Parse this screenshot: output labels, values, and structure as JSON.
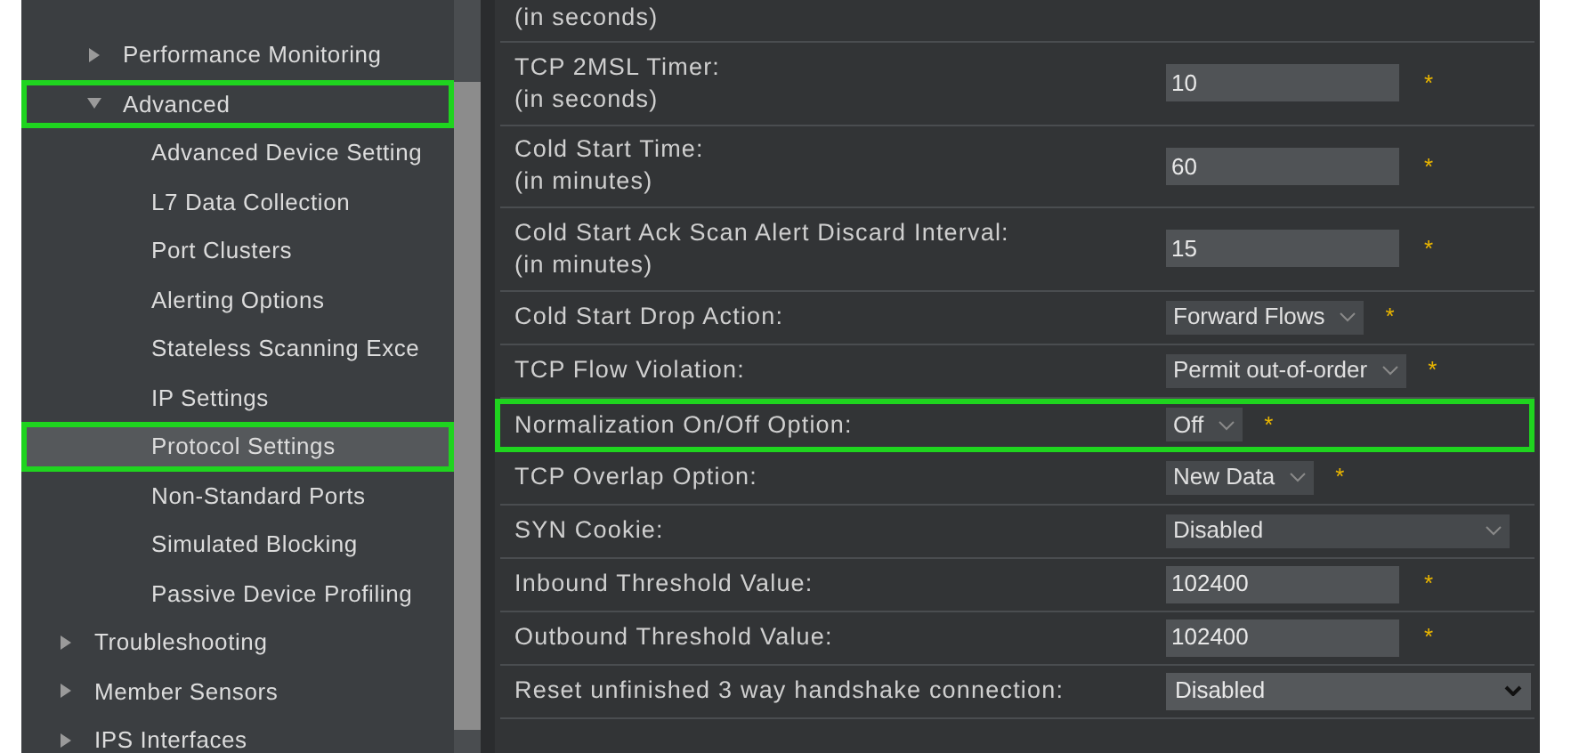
{
  "sidebar": {
    "group_items": [
      {
        "label": "Performance Monitoring",
        "expanded": false,
        "selected": false,
        "highlighted": false
      },
      {
        "label": "Advanced",
        "expanded": true,
        "selected": false,
        "highlighted": true,
        "children": [
          {
            "label": "Advanced Device Setting",
            "selected": false,
            "highlighted": false
          },
          {
            "label": "L7 Data Collection",
            "selected": false,
            "highlighted": false
          },
          {
            "label": "Port Clusters",
            "selected": false,
            "highlighted": false
          },
          {
            "label": "Alerting Options",
            "selected": false,
            "highlighted": false
          },
          {
            "label": "Stateless Scanning Exce",
            "selected": false,
            "highlighted": false
          },
          {
            "label": "IP Settings",
            "selected": false,
            "highlighted": false
          },
          {
            "label": "Protocol Settings",
            "selected": true,
            "highlighted": true
          },
          {
            "label": "Non-Standard Ports",
            "selected": false,
            "highlighted": false
          },
          {
            "label": "Simulated Blocking",
            "selected": false,
            "highlighted": false
          },
          {
            "label": "Passive Device Profiling",
            "selected": false,
            "highlighted": false
          }
        ]
      }
    ],
    "items": [
      {
        "label": "Troubleshooting",
        "expanded": false,
        "selected": false,
        "highlighted": false
      },
      {
        "label": "Member Sensors",
        "expanded": false,
        "selected": false,
        "highlighted": false
      },
      {
        "label": "IPS Interfaces",
        "expanded": false,
        "selected": false,
        "highlighted": false
      }
    ]
  },
  "settings": {
    "rows": [
      {
        "label": "(in seconds)",
        "kind": "partial",
        "highlighted": false
      },
      {
        "label": "TCP 2MSL Timer:",
        "sublabel": "(in seconds)",
        "kind": "input",
        "value": "10",
        "mark": "*",
        "highlighted": false
      },
      {
        "label": "Cold Start Time:",
        "sublabel": "(in minutes)",
        "kind": "input",
        "value": "60",
        "mark": "*",
        "highlighted": false
      },
      {
        "label": "Cold Start Ack Scan Alert Discard Interval:",
        "sublabel": "(in minutes)",
        "kind": "input",
        "value": "15",
        "mark": "*",
        "highlighted": false
      },
      {
        "label": "Cold Start Drop Action:",
        "kind": "select",
        "value": "Forward Flows",
        "mark": "*",
        "highlighted": false
      },
      {
        "label": "TCP Flow Violation:",
        "kind": "select",
        "value": "Permit out-of-order",
        "mark": "*",
        "highlighted": false
      },
      {
        "label": "Normalization On/Off Option:",
        "kind": "select",
        "value": "Off",
        "mark": "*",
        "highlighted": true
      },
      {
        "label": "TCP Overlap Option:",
        "kind": "select",
        "value": "New Data",
        "mark": "*",
        "highlighted": false
      },
      {
        "label": "SYN Cookie:",
        "kind": "wide-select",
        "value": "Disabled",
        "highlighted": false
      },
      {
        "label": "Inbound Threshold Value:",
        "kind": "input",
        "value": "102400",
        "mark": "*",
        "highlighted": false
      },
      {
        "label": "Outbound Threshold Value:",
        "kind": "input",
        "value": "102400",
        "mark": "*",
        "highlighted": false
      },
      {
        "label": "Reset unfinished 3 way handshake connection:",
        "kind": "dropdown",
        "value": "Disabled",
        "highlighted": false
      }
    ]
  }
}
